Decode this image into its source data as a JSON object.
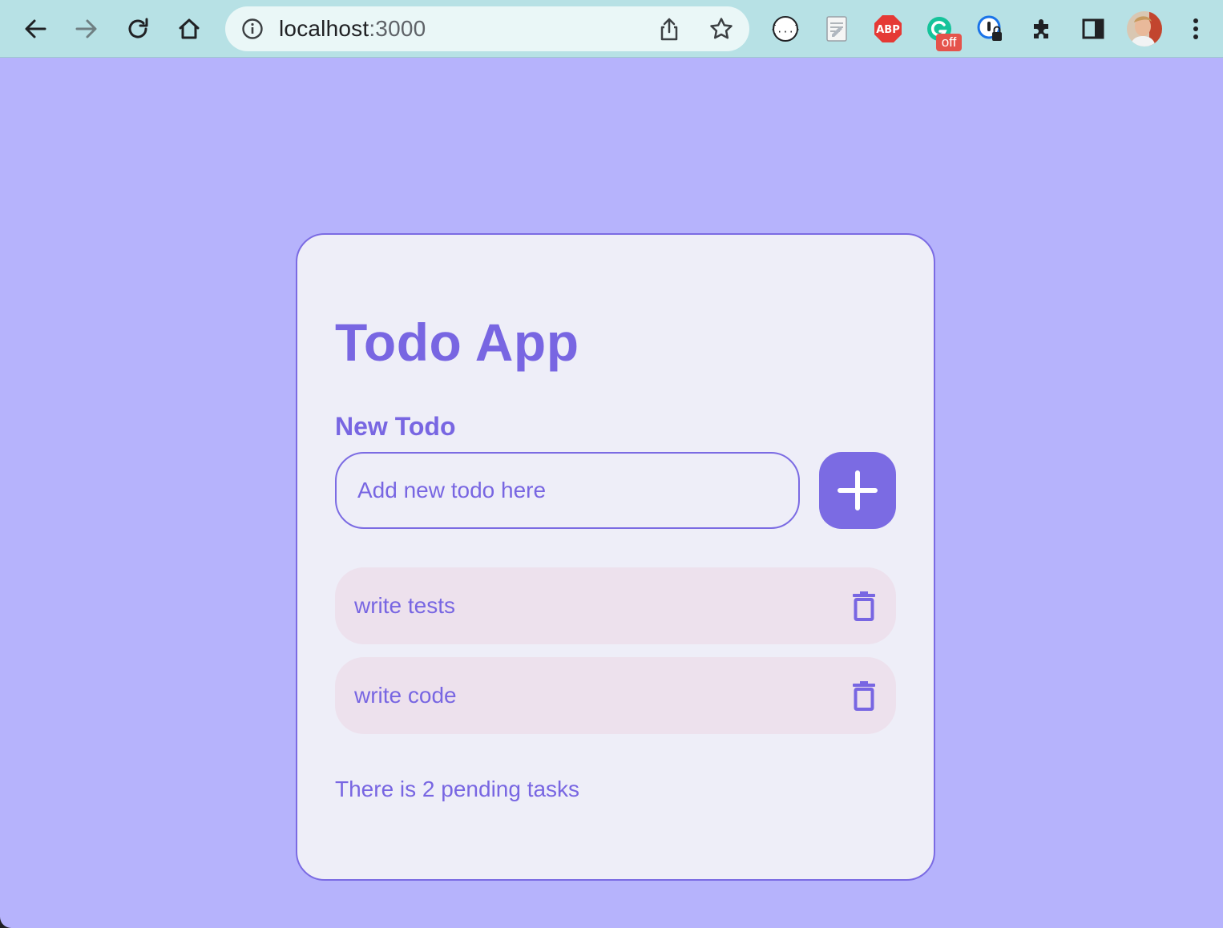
{
  "browser": {
    "url_host": "localhost",
    "url_port": ":3000",
    "extensions": [
      {
        "name": "json-viewer-icon"
      },
      {
        "name": "notes-extension-icon"
      },
      {
        "name": "adblock-plus-icon",
        "label": "ABP"
      },
      {
        "name": "grammarly-icon",
        "badge": "off"
      },
      {
        "name": "password-manager-icon"
      },
      {
        "name": "extensions-puzzle-icon"
      },
      {
        "name": "side-panel-icon"
      }
    ],
    "colors": {
      "toolbar": "#b7e1e5",
      "omnibox": "#eaf7f7"
    }
  },
  "app": {
    "title": "Todo App",
    "new_todo_label": "New Todo",
    "input_placeholder": "Add new todo here",
    "input_value": "",
    "add_button_icon": "plus-icon",
    "todos": [
      {
        "text": "write tests",
        "delete_icon": "trash-icon"
      },
      {
        "text": "write code",
        "delete_icon": "trash-icon"
      }
    ],
    "pending_text": "There is 2 pending tasks",
    "colors": {
      "background": "#b6b3fc",
      "card": "#eeeef8",
      "accent": "#7b6be3",
      "todo_item": "#ede1ed"
    }
  }
}
